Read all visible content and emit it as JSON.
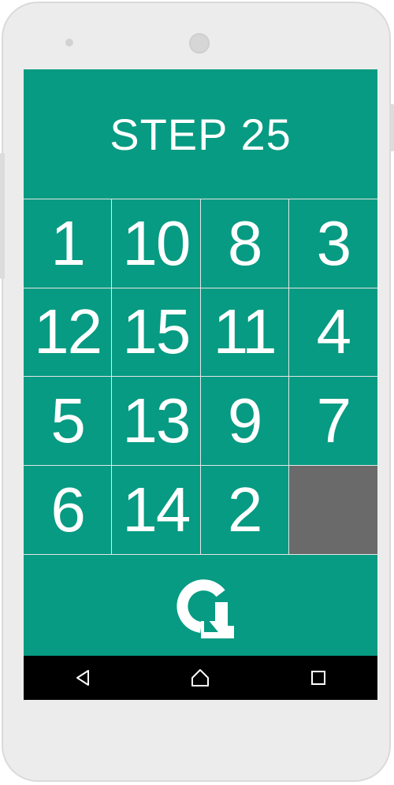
{
  "header": {
    "step_label": "STEP",
    "step_count": "25"
  },
  "board": {
    "tiles": [
      "1",
      "10",
      "8",
      "3",
      "12",
      "15",
      "11",
      "4",
      "5",
      "13",
      "9",
      "7",
      "6",
      "14",
      "2",
      ""
    ]
  },
  "controls": {
    "reset_icon": "restart-icon"
  },
  "navigation": {
    "back_icon": "back-triangle-icon",
    "home_icon": "home-icon",
    "recents_icon": "recents-square-icon"
  },
  "colors": {
    "accent": "#069b82",
    "empty_tile": "#6a6a6a",
    "text": "#ffffff",
    "nav_bar": "#000000"
  }
}
